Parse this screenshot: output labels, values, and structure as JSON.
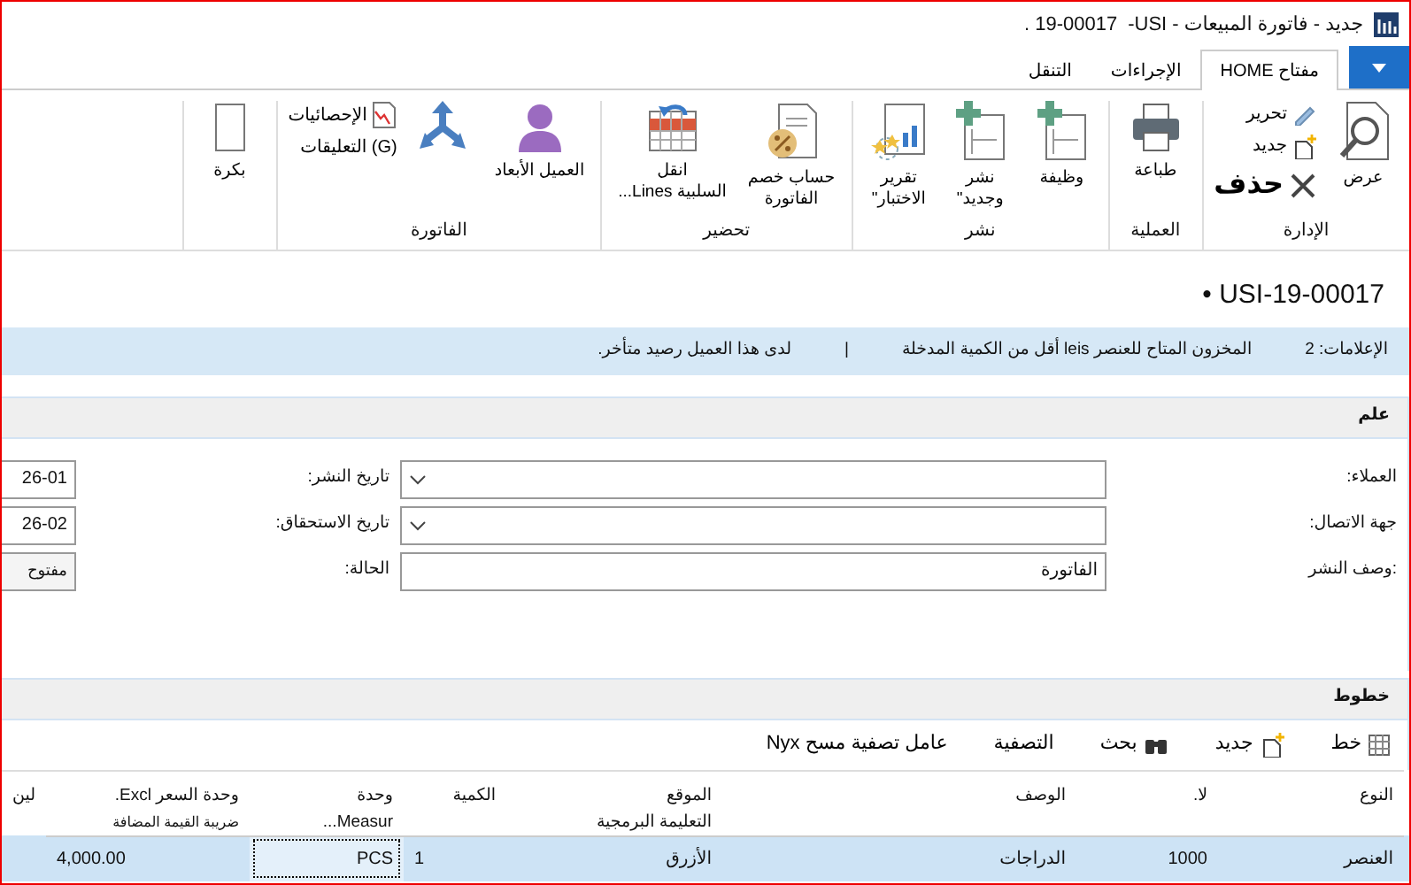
{
  "window": {
    "title": "جديد - فاتورة المبيعات - USI-",
    "document_no": "19-00017 ."
  },
  "ribbon": {
    "tabs": [
      {
        "label": "مفتاح HOME",
        "selected": true
      },
      {
        "label": "الإجراءات",
        "selected": false
      },
      {
        "label": "التنقل",
        "selected": false
      }
    ],
    "groups": [
      {
        "label": "الإدارة",
        "buttons": [
          {
            "kind": "large",
            "lines": [
              "عرض"
            ]
          },
          {
            "kind": "small",
            "lines": [
              "تحرير"
            ]
          },
          {
            "kind": "small",
            "lines": [
              "جديد"
            ]
          },
          {
            "kind": "small",
            "lines": [
              "حذف"
            ],
            "emphasis": true
          }
        ]
      },
      {
        "label": "العملية",
        "buttons": [
          {
            "kind": "large",
            "lines": [
              "طباعة"
            ]
          }
        ]
      },
      {
        "label": "نشر",
        "buttons": [
          {
            "kind": "large",
            "lines": [
              "وظيفة"
            ]
          },
          {
            "kind": "large",
            "lines": [
              "نشر",
              "وجديد\""
            ]
          },
          {
            "kind": "large",
            "lines": [
              "تقرير",
              "الاختبار\""
            ]
          }
        ]
      },
      {
        "label": "تحضير",
        "buttons": [
          {
            "kind": "large",
            "lines": [
              "حساب خصم",
              "الفاتورة"
            ]
          },
          {
            "kind": "large",
            "lines": [
              "انقل",
              "السلبية    Lines..."
            ]
          }
        ]
      },
      {
        "label": "الفاتورة",
        "buttons": [
          {
            "kind": "large",
            "lines": [
              "العميل الأبعاد"
            ]
          },
          {
            "kind": "large"
          },
          {
            "kind": "small",
            "lines": [
              "الإحصائيات"
            ]
          },
          {
            "kind": "small",
            "lines": [
              "(G) التعليقات"
            ]
          }
        ]
      },
      {
        "buttons": [
          {
            "kind": "large",
            "lines": [
              "بكرة"
            ]
          }
        ]
      }
    ]
  },
  "heading": "USI-19-00017 •",
  "notifications": {
    "label": "الإعلامات: 2",
    "separator": "|",
    "messages": [
      "المخزون المتاح للعنصر leis أقل من الكمية المدخلة",
      "لدى هذا العميل رصيد متأخر."
    ]
  },
  "general": {
    "title": "علم",
    "fields": [
      {
        "label": "العملاء:",
        "kind": "dropdown"
      },
      {
        "label": "تاريخ النشر:",
        "value": "26-01"
      },
      {
        "label": "جهة الاتصال:",
        "kind": "dropdown"
      },
      {
        "label": "تاريخ الاستحقاق:",
        "value": "26-02"
      },
      {
        "label": ":وصف النشر",
        "value": "الفاتورة"
      },
      {
        "label": "الحالة:",
        "value": "مفتوح"
      }
    ]
  },
  "lines": {
    "title": "خطوط",
    "toolbar": [
      "خط",
      "جديد",
      "بحث",
      "التصفية",
      "عامل تصفية مسح Nyx"
    ],
    "columns": [
      {
        "label": "النوع"
      },
      {
        "label": "لا."
      },
      {
        "label": "الوصف"
      },
      {
        "label": "الموقع",
        "sublabel": "التعليمة البرمجية"
      },
      {
        "label": "الكمية"
      },
      {
        "label": "وحدة",
        "sublabel": "Measur..."
      },
      {
        "label": "وحدة السعر Excl.",
        "sublabel": "ضريبة القيمة المضافة"
      },
      {
        "label": "لين"
      }
    ],
    "rows": [
      {
        "selected": true,
        "cells": [
          "العنصر",
          "1000",
          "الدراجات",
          "الأزرق",
          "1",
          "PCS",
          "4,000.00"
        ]
      }
    ]
  }
}
